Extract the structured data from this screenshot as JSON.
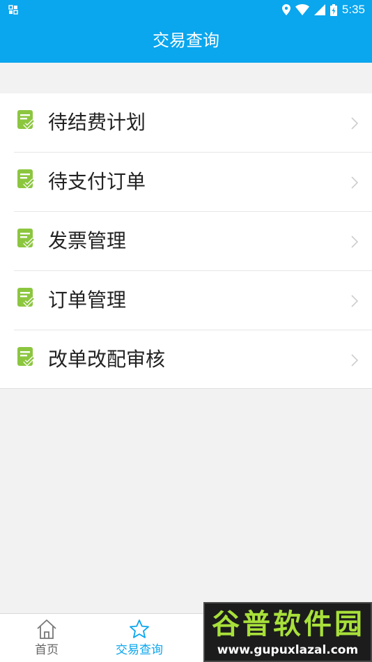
{
  "status_bar": {
    "time": "5:35",
    "icons": [
      "notification-grid-icon",
      "location-icon",
      "wifi-icon",
      "signal-icon",
      "battery-charging-icon"
    ]
  },
  "app_bar": {
    "title": "交易查询"
  },
  "menu": {
    "items": [
      {
        "label": "待结费计划",
        "icon": "document-check-icon"
      },
      {
        "label": "待支付订单",
        "icon": "document-check-icon"
      },
      {
        "label": "发票管理",
        "icon": "document-check-icon"
      },
      {
        "label": "订单管理",
        "icon": "document-check-icon"
      },
      {
        "label": "改单改配审核",
        "icon": "document-check-icon"
      }
    ]
  },
  "tab_bar": {
    "tabs": [
      {
        "label": "首页",
        "icon": "home-icon",
        "active": false
      },
      {
        "label": "交易查询",
        "icon": "star-icon",
        "active": true
      }
    ]
  },
  "watermark": {
    "title": "谷普软件园",
    "url": "www.gupuxlazal.com"
  },
  "colors": {
    "primary": "#0aa6ee",
    "icon_green": "#8cc63f",
    "text": "#222222",
    "background": "#f2f2f2"
  }
}
